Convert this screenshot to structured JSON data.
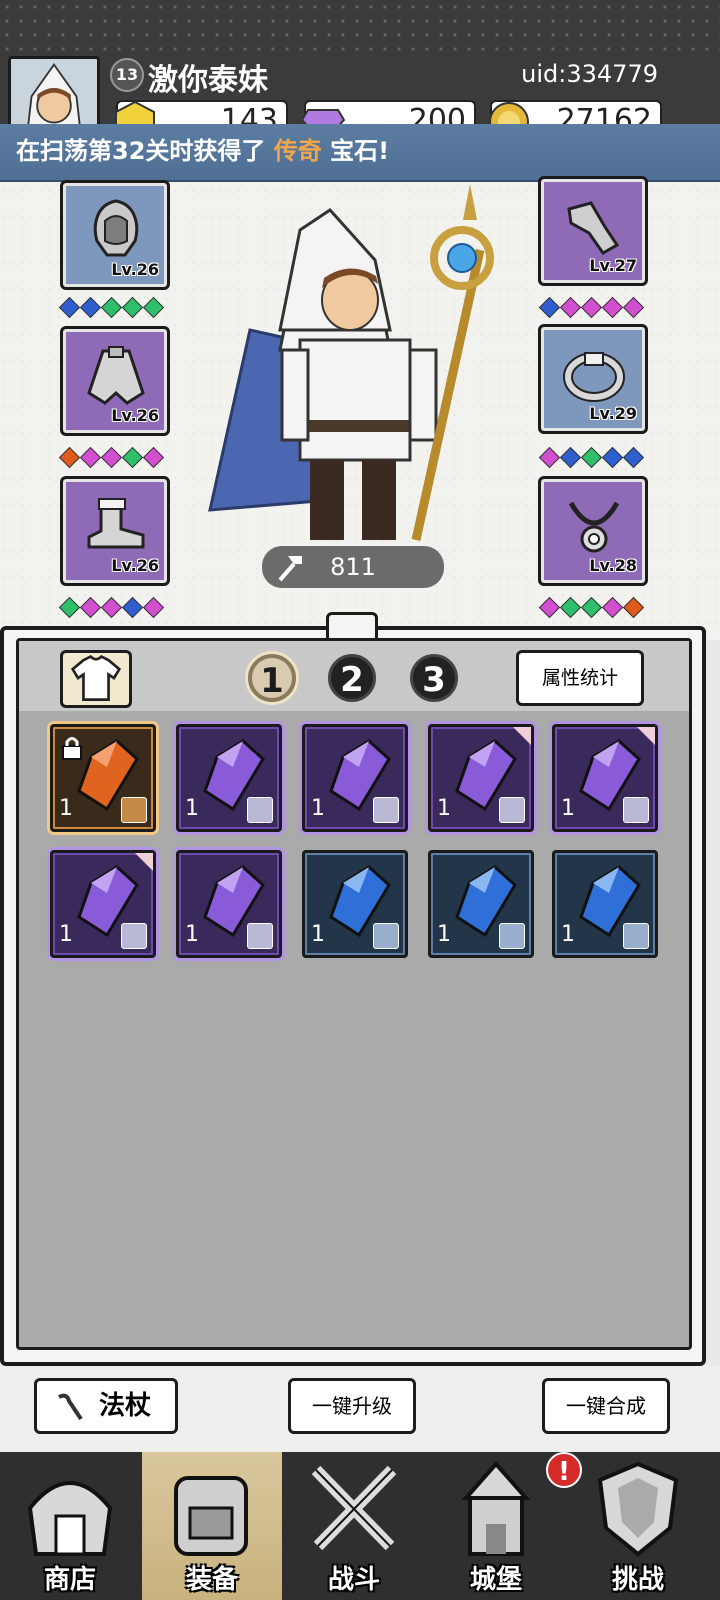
{
  "player": {
    "level": "13",
    "name": "激你泰妹",
    "uid": "uid:334779"
  },
  "resources": {
    "energy": "143",
    "gems": "200",
    "gold": "27162"
  },
  "ticker": {
    "prefix": "在扫荡第32关时获得了",
    "highlight": "传奇",
    "suffix": "宝石!"
  },
  "equipment": {
    "slots": [
      {
        "name": "hood",
        "level": "Lv.26",
        "rarity": "blue"
      },
      {
        "name": "cape",
        "level": "Lv.26",
        "rarity": "purple"
      },
      {
        "name": "boots",
        "level": "Lv.26",
        "rarity": "purple"
      },
      {
        "name": "bracer",
        "level": "Lv.27",
        "rarity": "purple"
      },
      {
        "name": "ring",
        "level": "Lv.29",
        "rarity": "blue"
      },
      {
        "name": "necklace",
        "level": "Lv.28",
        "rarity": "purple"
      }
    ]
  },
  "hero": {
    "power": "811"
  },
  "inventory": {
    "tabs": [
      "1",
      "2",
      "3"
    ],
    "active_tab": "1",
    "stats_label": "属性统计",
    "items": [
      {
        "rarity": "orange",
        "qty": "1",
        "locked": true
      },
      {
        "rarity": "purple",
        "qty": "1"
      },
      {
        "rarity": "purple",
        "qty": "1"
      },
      {
        "rarity": "purple",
        "qty": "1"
      },
      {
        "rarity": "purple",
        "qty": "1"
      },
      {
        "rarity": "purple",
        "qty": "1"
      },
      {
        "rarity": "purple",
        "qty": "1"
      },
      {
        "rarity": "blue",
        "qty": "1"
      },
      {
        "rarity": "blue",
        "qty": "1"
      },
      {
        "rarity": "blue",
        "qty": "1"
      }
    ]
  },
  "actions": {
    "staff": "法杖",
    "upgrade_all": "一键升级",
    "merge_all": "一键合成"
  },
  "nav": {
    "shop": "商店",
    "equipment": "装备",
    "battle": "战斗",
    "castle": "城堡",
    "challenge": "挑战",
    "castle_alert": "!"
  },
  "colors": {
    "ticker_highlight": "#f3a64a",
    "rarity_purple": "#8f6ab6",
    "rarity_blue": "#7e97bc",
    "rarity_orange": "#e05a1b"
  }
}
